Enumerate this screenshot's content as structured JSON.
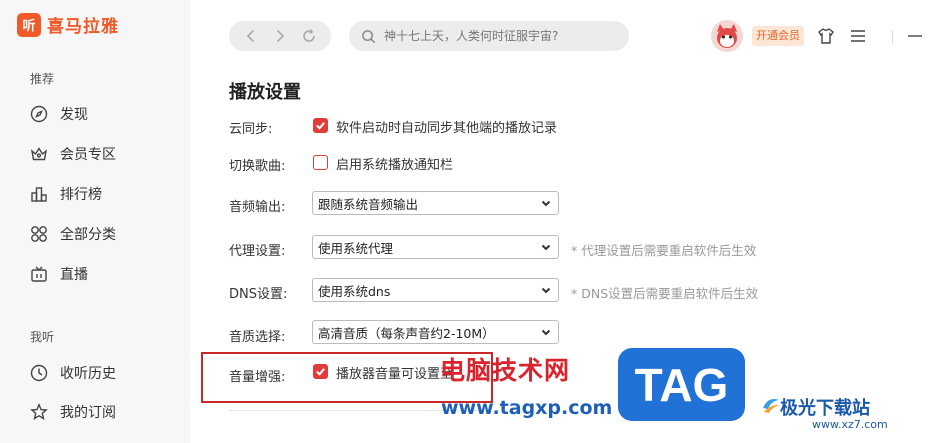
{
  "app": {
    "logo_glyph": "听",
    "logo_text": "喜马拉雅",
    "brand_color": "#f05a28"
  },
  "sidebar": {
    "section_recommend": "推荐",
    "section_mine": "我听",
    "items": [
      {
        "label": "发现",
        "icon": "compass-icon"
      },
      {
        "label": "会员专区",
        "icon": "crown-icon"
      },
      {
        "label": "排行榜",
        "icon": "ranking-icon"
      },
      {
        "label": "全部分类",
        "icon": "grid-icon"
      },
      {
        "label": "直播",
        "icon": "tv-icon"
      },
      {
        "label": "收听历史",
        "icon": "clock-icon"
      },
      {
        "label": "我的订阅",
        "icon": "star-icon"
      }
    ]
  },
  "topbar": {
    "search_placeholder": "神十七上天，人类何时征服宇宙?",
    "vip_label": "开通会员",
    "accent_color": "#e5662a"
  },
  "settings": {
    "title": "播放设置",
    "cloud_sync": {
      "label": "云同步:",
      "text": "软件启动时自动同步其他端的播放记录",
      "checked": true
    },
    "switch_song": {
      "label": "切换歌曲:",
      "text": "启用系统播放通知栏",
      "checked": false
    },
    "audio_output": {
      "label": "音频输出:",
      "value": "跟随系统音频输出"
    },
    "proxy": {
      "label": "代理设置:",
      "value": "使用系统代理",
      "note": "* 代理设置后需要重启软件后生效"
    },
    "dns": {
      "label": "DNS设置:",
      "value": "使用系统dns",
      "note": "* DNS设置后需要重启软件后生效"
    },
    "quality": {
      "label": "音质选择:",
      "value": "高清音质（每条声音约2-10M）"
    },
    "volume_boost": {
      "label": "音量增强:",
      "text": "播放器音量可设置至",
      "checked": true
    },
    "check_color": "#e03c3c"
  },
  "watermark": {
    "cn_text": "电脑技术网",
    "url": "www.tagxp.com",
    "tag": "TAG",
    "jg_text": "极光下载站",
    "jg_url": "www.xz7.com"
  }
}
